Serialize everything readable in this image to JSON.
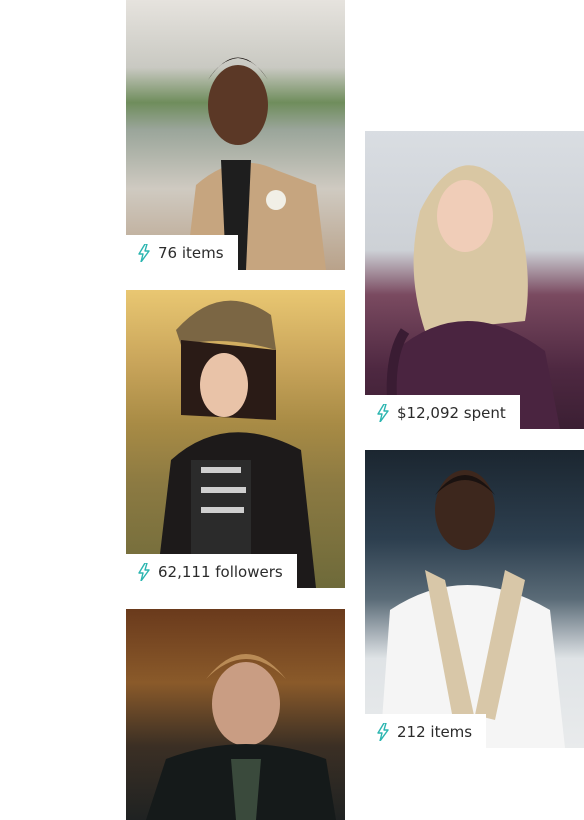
{
  "cards": [
    {
      "name": "profile-card-1",
      "stat": "76 items",
      "accent": "#2bb5b0"
    },
    {
      "name": "profile-card-2",
      "stat": "$12,092 spent",
      "accent": "#2bb5b0"
    },
    {
      "name": "profile-card-3",
      "stat": "62,111 followers",
      "accent": "#2bb5b0"
    },
    {
      "name": "profile-card-4",
      "stat": "212 items",
      "accent": "#2bb5b0"
    },
    {
      "name": "profile-card-5",
      "stat": "",
      "accent": "#2bb5b0"
    }
  ],
  "icons": {
    "stat_icon": "lightning-bolt-icon"
  }
}
